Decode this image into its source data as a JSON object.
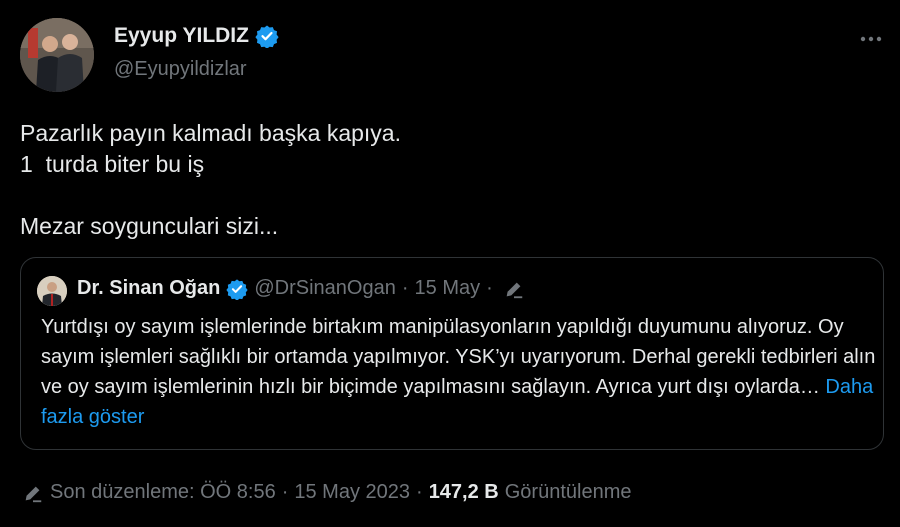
{
  "author": {
    "display_name": "Eyyup YILDIZ",
    "handle": "@Eyupyildizlar",
    "verified": true
  },
  "tweet": {
    "text": "Pazarlık payın kalmadı başka kapıya.\n1  turda biter bu iş\n\nMezar soygunculari sizi..."
  },
  "quoted_tweet": {
    "display_name": "Dr. Sinan Oğan",
    "handle": "@DrSinanOgan",
    "separator": "·",
    "date": "15 May",
    "separator2": "·",
    "text": "Yurtdışı oy sayım işlemlerinde birtakım manipülasyonların yapıldığı duyumunu alıyoruz. Oy sayım işlemleri sağlıklı bir ortamda yapılmıyor. YSK’yı uyarıyorum. Derhal gerekli tedbirleri alın ve oy sayım işlemlerinin hızlı bir biçimde yapılmasını sağlayın. Ayrıca yurt dışı oylarda…",
    "show_more": "Daha fazla göster"
  },
  "meta": {
    "edited_label": "Son düzenleme: ÖÖ 8:56",
    "separator": "·",
    "date": "15 May 2023",
    "separator2": "·",
    "views_count": "147,2 B",
    "views_label": "Görüntülenme"
  },
  "icons": {
    "verified": "verified-badge-icon",
    "more": "more-dots-icon",
    "edit": "edit-pencil-icon"
  },
  "colors": {
    "background": "#000000",
    "text": "#e7e9ea",
    "secondary": "#71767b",
    "accent": "#1d9bf0",
    "border": "#2f3336"
  }
}
